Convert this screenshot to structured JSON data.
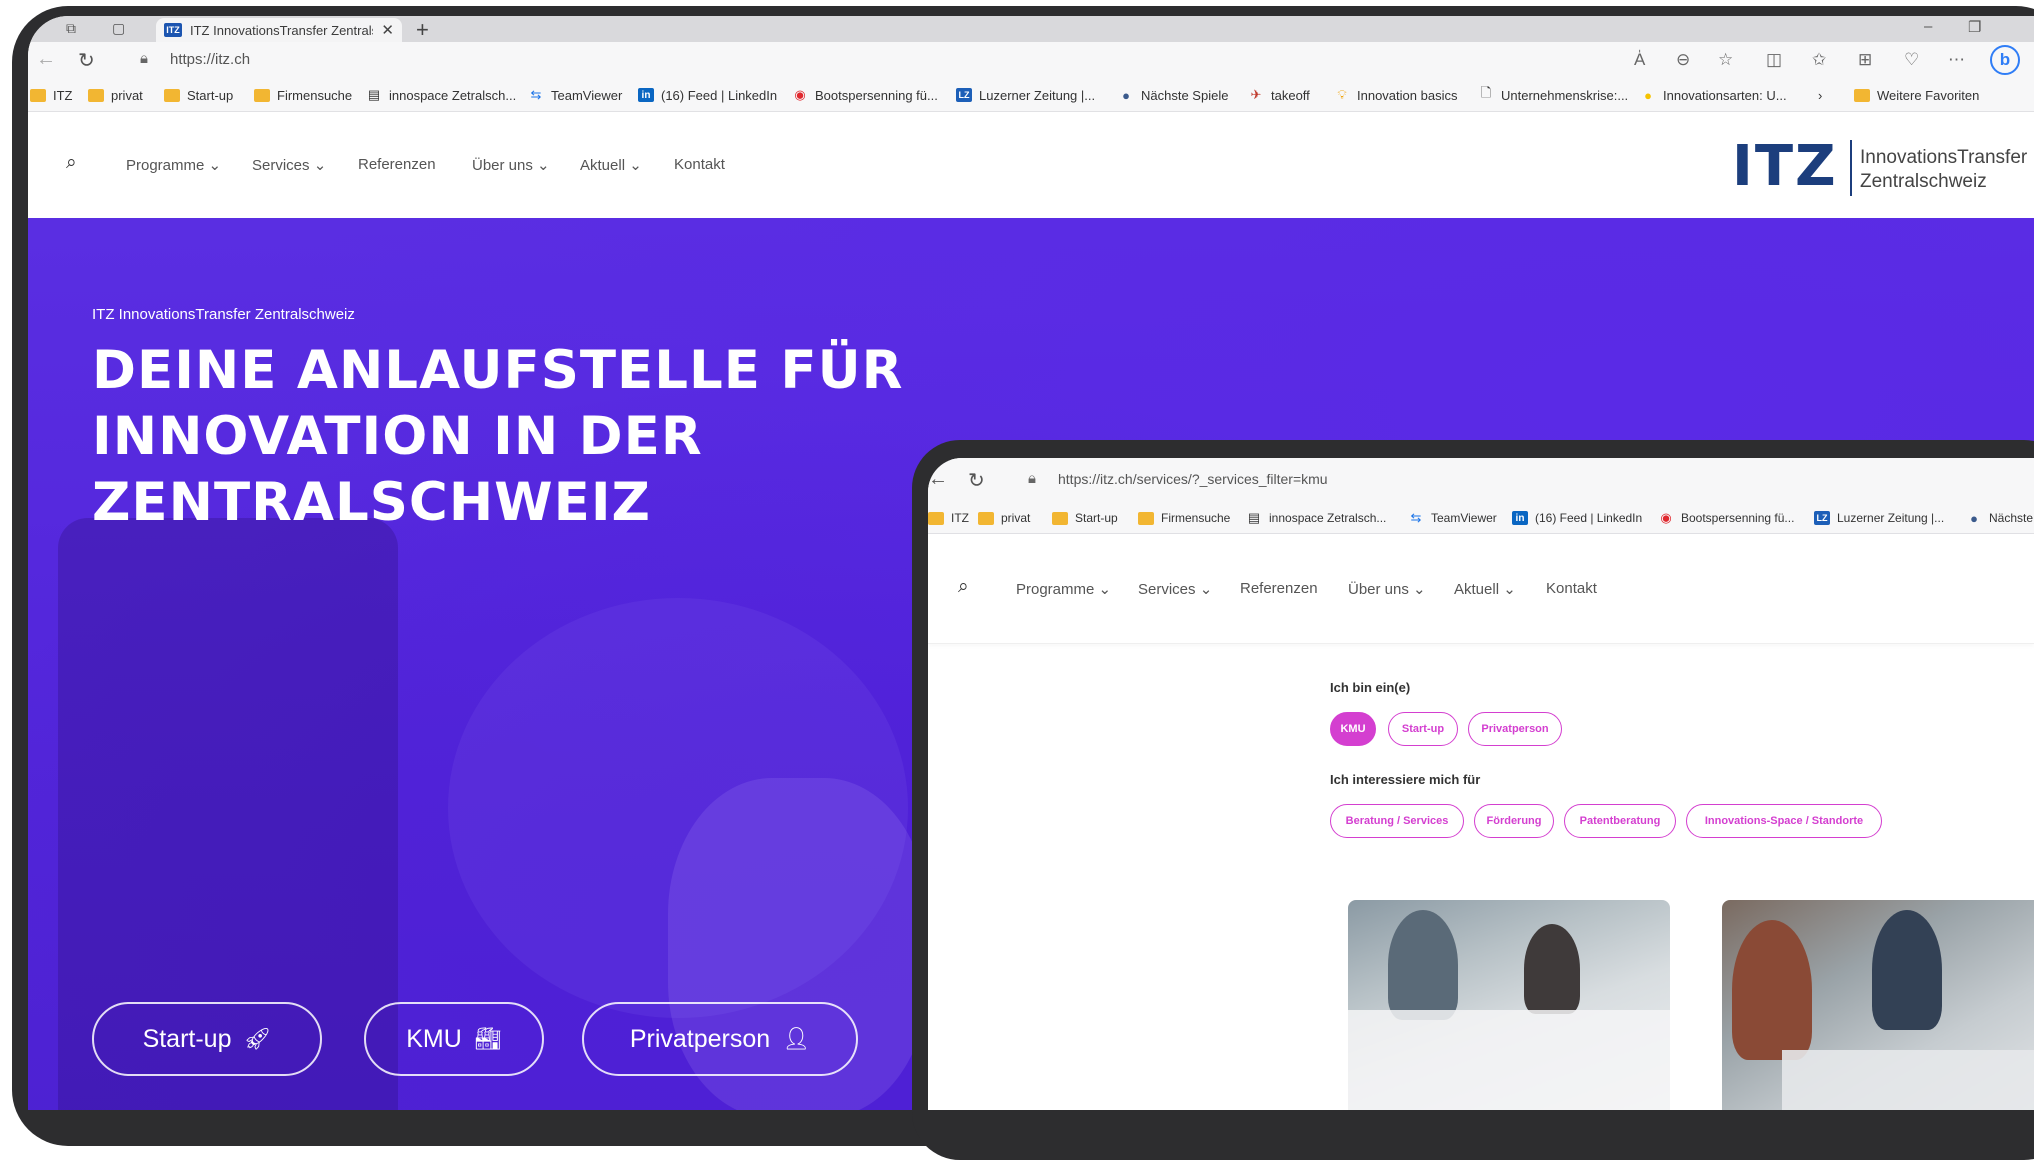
{
  "back_browser": {
    "tab_title": "ITZ InnovationsTransfer Zentralsc",
    "url": "https://itz.ch",
    "bookmarks": [
      "ITZ",
      "privat",
      "Start-up",
      "Firmensuche",
      "innospace Zetralsch...",
      "TeamViewer",
      "(16) Feed | LinkedIn",
      "Bootspersenning fü...",
      "Luzerner Zeitung |...",
      "Nächste Spiele",
      "takeoff",
      "Innovation basics",
      "Unternehmenskrise:...",
      "Innovationsarten: U...",
      "Weitere Favoriten"
    ]
  },
  "site": {
    "nav": [
      "Programme",
      "Services",
      "Referenzen",
      "Über uns",
      "Aktuell",
      "Kontakt"
    ],
    "logo_mark": "ITZ",
    "logo_line1": "InnovationsTransfer",
    "logo_line2": "Zentralschweiz"
  },
  "hero": {
    "kicker": "ITZ InnovationsTransfer Zentralschweiz",
    "title": "DEINE ANLAUFSTELLE FÜR INNOVATION IN DER ZENTRALSCHWEIZ",
    "cta": [
      "Start-up",
      "KMU",
      "Privatperson"
    ]
  },
  "front_browser": {
    "url": "https://itz.ch/services/?_services_filter=kmu",
    "bookmarks": [
      "ITZ",
      "privat",
      "Start-up",
      "Firmensuche",
      "innospace Zetralsch...",
      "TeamViewer",
      "(16) Feed | LinkedIn",
      "Bootspersenning fü...",
      "Luzerner Zeitung |...",
      "Nächste"
    ]
  },
  "filters": {
    "label_who": "Ich bin ein(e)",
    "who": [
      "KMU",
      "Start-up",
      "Privatperson"
    ],
    "who_active": "KMU",
    "label_interest": "Ich interessiere mich für",
    "interest": [
      "Beratung / Services",
      "Förderung",
      "Patentberatung",
      "Innovations-Space / Standorte"
    ]
  },
  "colors": {
    "hero_purple": "#5427dc",
    "brand_navy": "#1c3e7d",
    "pill_magenta": "#d43fd0"
  }
}
